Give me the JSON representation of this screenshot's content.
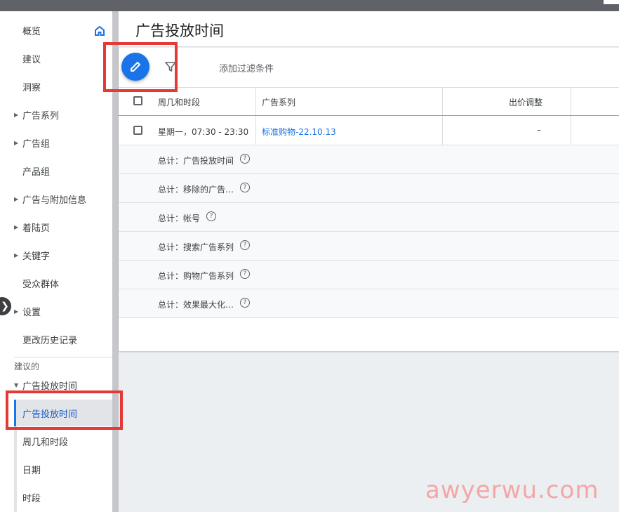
{
  "page": {
    "title": "广告投放时间"
  },
  "sidebar": {
    "items": [
      {
        "label": "概览",
        "caret": false
      },
      {
        "label": "建议",
        "caret": false
      },
      {
        "label": "洞察",
        "caret": false
      },
      {
        "label": "广告系列",
        "caret": true
      },
      {
        "label": "广告组",
        "caret": true
      },
      {
        "label": "产品组",
        "caret": false
      },
      {
        "label": "广告与附加信息",
        "caret": true
      },
      {
        "label": "着陆页",
        "caret": true
      },
      {
        "label": "关键字",
        "caret": true
      },
      {
        "label": "受众群体",
        "caret": false
      },
      {
        "label": "设置",
        "caret": true
      },
      {
        "label": "更改历史记录",
        "caret": false
      }
    ],
    "section_label": "建议的",
    "group_label": "广告投放时间",
    "subitems": [
      {
        "label": "广告投放时间",
        "active": true
      },
      {
        "label": "周几和时段",
        "active": false
      },
      {
        "label": "日期",
        "active": false
      },
      {
        "label": "时段",
        "active": false
      }
    ],
    "expand_glyph": "❯"
  },
  "toolbar": {
    "filter_placeholder": "添加过滤条件"
  },
  "table": {
    "headers": [
      "周几和时段",
      "广告系列",
      "出价调整"
    ],
    "rows": [
      {
        "day_time": "星期一，07:30 - 23:30",
        "campaign": "标准购物-22.10.13",
        "bid_adjust": "–"
      }
    ],
    "totals": [
      "总计：广告投放时间",
      "总计：移除的广告…",
      "总计：帐号",
      "总计：搜索广告系列",
      "总计：购物广告系列",
      "总计：效果最大化…"
    ],
    "help_glyph": "?"
  },
  "watermark": "awyerwu.com",
  "colors": {
    "accent": "#1a73e8",
    "highlight": "#e53935"
  }
}
